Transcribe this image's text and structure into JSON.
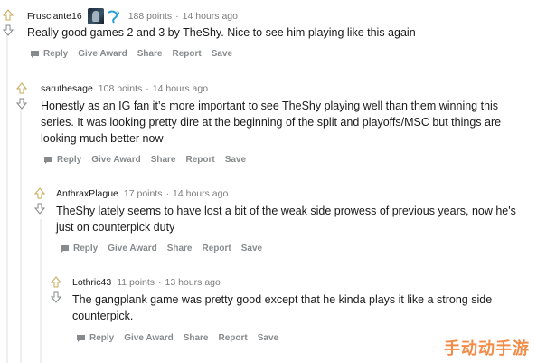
{
  "comments": [
    {
      "author": "Frusciante16",
      "points": "188 points",
      "time": "14 hours ago",
      "body": "Really good games 2 and 3 by TheShy. Nice to see him playing like this again",
      "flair": [
        "team-flair-image",
        "team-logo-icon"
      ]
    },
    {
      "author": "saruthesage",
      "points": "108 points",
      "time": "14 hours ago",
      "body_lines": [
        "Honestly as an IG fan it’s more important to see TheShy playing well than them winning this",
        "series. It was looking pretty dire at the beginning of the split and playoffs/MSC but things are",
        "looking much better now"
      ]
    },
    {
      "author": "AnthraxPlague",
      "points": "17 points",
      "time": "14 hours ago",
      "body_lines": [
        "TheShy lately seems to have lost a bit of the weak side prowess of previous years, now he's",
        "just on counterpick duty"
      ]
    },
    {
      "author": "Lothric43",
      "points": "11 points",
      "time": "13 hours ago",
      "body_lines": [
        "The gangplank game was pretty good except that he kinda plays it like a strong side",
        "counterpick."
      ]
    }
  ],
  "actions": {
    "reply": "Reply",
    "give_award": "Give Award",
    "share": "Share",
    "report": "Report",
    "save": "Save"
  },
  "separator": "·",
  "watermark": "手动动手游",
  "colors": {
    "text": "#1a1a1b",
    "meta": "#7c7c7c",
    "action": "#878a8c",
    "upvote": "#c9a95a",
    "thread_line": "#edeff1",
    "watermark": "#f07a2a"
  }
}
